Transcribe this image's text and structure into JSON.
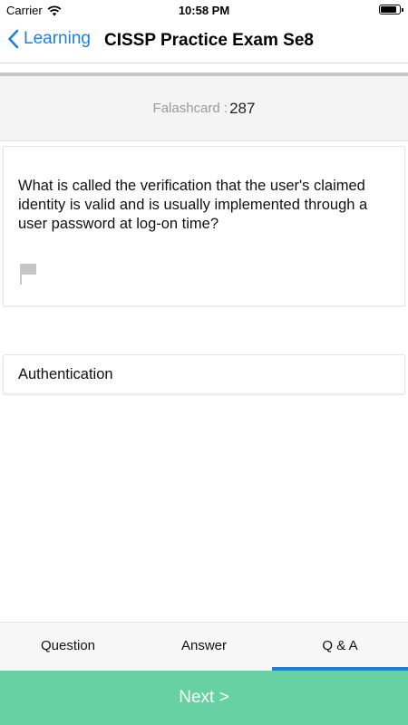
{
  "status_bar": {
    "carrier": "Carrier",
    "time": "10:58 PM"
  },
  "nav": {
    "back_label": "Learning",
    "title": "CISSP Practice Exam Se8"
  },
  "counter": {
    "label": "Falashcard :",
    "value": "287"
  },
  "question": {
    "text": "What is called the verification that the user's claimed identity is valid and is usually implemented through a user password at log-on time?"
  },
  "answer": {
    "text": "Authentication"
  },
  "tabs": [
    {
      "label": "Question",
      "active": false
    },
    {
      "label": "Answer",
      "active": false
    },
    {
      "label": "Q & A",
      "active": true
    }
  ],
  "next_button": {
    "label": "Next >"
  },
  "icons": {
    "back": "chevron-left-icon",
    "flag": "flag-icon",
    "wifi": "wifi-icon",
    "battery": "battery-icon"
  },
  "colors": {
    "accent": "#1e7fe0",
    "next_bg": "#67d1a3",
    "counter_bg": "#f4f4f4"
  }
}
